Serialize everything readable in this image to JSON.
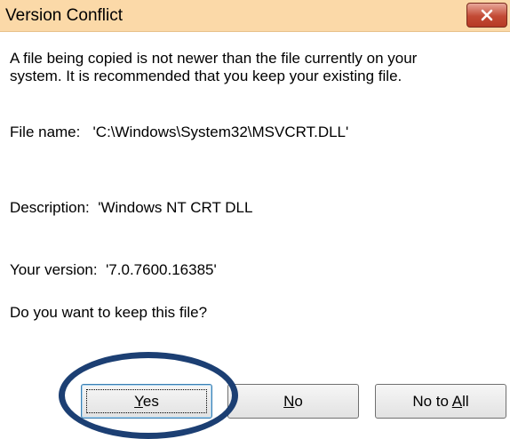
{
  "window": {
    "title": "Version Conflict",
    "close_icon": "close-icon",
    "titlebar_color": "#fbd9a8",
    "close_color": "#c24a35"
  },
  "body": {
    "message_line1": "A file being copied is not newer than the file currently on your",
    "message_line2": "system. It is recommended that you keep your existing file.",
    "file_name_label": "File name:",
    "file_name_value": "'C:\\Windows\\System32\\MSVCRT.DLL'",
    "description_label": "Description:",
    "description_value": "'Windows NT CRT DLL",
    "version_label": "Your version:",
    "version_value": "'7.0.7600.16385'",
    "question": "Do you want to keep this file?"
  },
  "buttons": {
    "yes": {
      "mnemonic": "Y",
      "rest": "es"
    },
    "no": {
      "mnemonic": "N",
      "rest": "o"
    },
    "no_to_all": {
      "prefix": "No to ",
      "mnemonic": "A",
      "rest": "ll"
    }
  },
  "annotation": {
    "ellipse_color": "#1c3f73",
    "target": "yes-button"
  }
}
